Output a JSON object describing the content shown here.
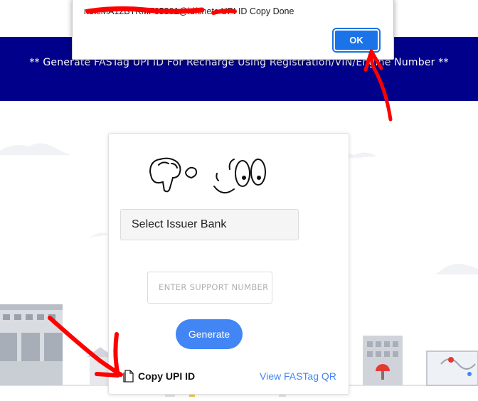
{
  "banner": {
    "text": "** Generate FASTag UPI ID For Recharge Using Registration/VIN/Engine Number **"
  },
  "dialog": {
    "message": "netcMA12BTKMF65301@idfcnetc UPI ID Copy Done",
    "ok_label": "OK"
  },
  "form": {
    "bank_select": "Select Issuer Bank",
    "support_placeholder": "ENTER SUPPORT NUMBER",
    "generate_label": "Generate",
    "copy_upi_label": "Copy UPI ID",
    "view_qr_label": "View FASTag QR"
  },
  "icons": {
    "copy": "document-icon"
  },
  "colors": {
    "banner": "#00008b",
    "primary": "#4285f4",
    "ok": "#1a73e8",
    "annotation": "#ff0000"
  }
}
